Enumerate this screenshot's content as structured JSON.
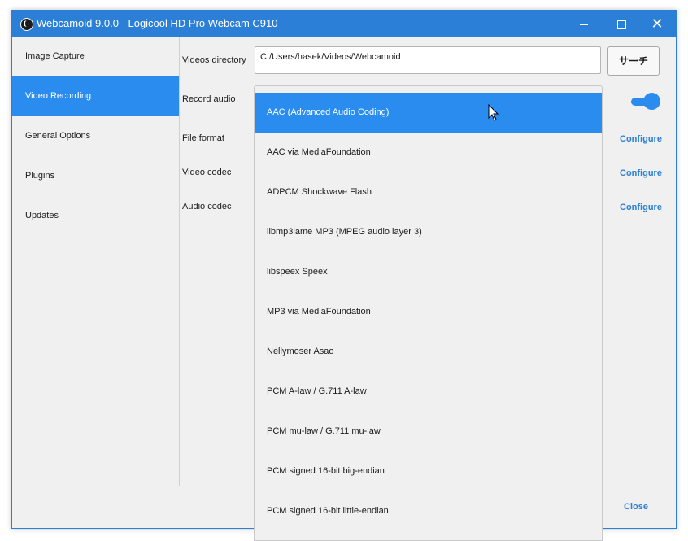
{
  "window": {
    "title": "Webcamoid 9.0.0 - Logicool HD Pro Webcam C910",
    "controls": {
      "minimize": "–",
      "maximize": "□",
      "close": "✕"
    }
  },
  "sidebar": {
    "items": [
      {
        "label": "Image Capture",
        "active": false
      },
      {
        "label": "Video Recording",
        "active": true
      },
      {
        "label": "General Options",
        "active": false
      },
      {
        "label": "Plugins",
        "active": false
      },
      {
        "label": "Updates",
        "active": false
      }
    ]
  },
  "recording": {
    "videos_directory_label": "Videos directory",
    "videos_directory_value": "C:/Users/hasek/Videos/Webcamoid",
    "search_button": "サーチ",
    "record_audio_label": "Record audio",
    "record_audio_on": true,
    "file_format_label": "File format",
    "video_codec_label": "Video codec",
    "audio_codec_label": "Audio codec",
    "configure": "Configure"
  },
  "dropdown": {
    "selected_index": 0,
    "options": [
      "AAC (Advanced Audio Coding)",
      "AAC via MediaFoundation",
      "ADPCM Shockwave Flash",
      "libmp3lame MP3 (MPEG audio layer 3)",
      "libspeex Speex",
      "MP3 via MediaFoundation",
      "Nellymoser Asao",
      "PCM A-law / G.711 A-law",
      "PCM mu-law / G.711 mu-law",
      "PCM signed 16-bit big-endian",
      "PCM signed 16-bit little-endian"
    ]
  },
  "footer": {
    "close_label": "Close"
  },
  "colors": {
    "accent": "#2b8cf0",
    "titlebar": "#2b7fd6",
    "link": "#2b7fd6"
  }
}
